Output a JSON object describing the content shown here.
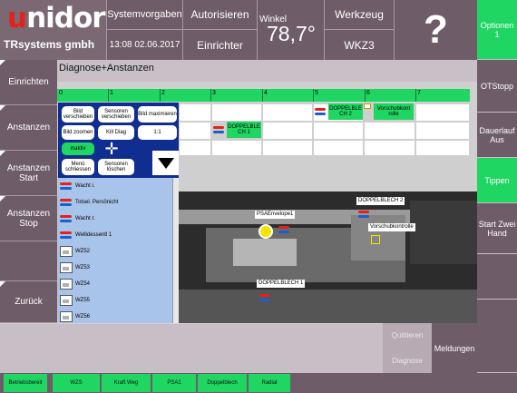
{
  "logo": {
    "brand": "unidor",
    "subtitle": "TRsystems gmbh"
  },
  "header": {
    "systemvorgaben": "Systemvorgaben",
    "datetime": "13:08 02.06.2017",
    "autorisieren": "Autorisieren",
    "einrichter": "Einrichter",
    "winkel_label": "Winkel",
    "winkel_value": "78,7°",
    "werkzeug_label": "Werkzeug",
    "werkzeug_value": "WKZ3",
    "help": "?"
  },
  "left_menu": [
    "Einrichten",
    "Anstanzen",
    "Anstanzen Start",
    "Anstanzen Stop",
    "Zurück"
  ],
  "right_menu": [
    "Optionen 1",
    "OTStopp",
    "Dauerlauf Aus",
    "Tippen",
    "Start Zwei Hand"
  ],
  "main": {
    "title": "Diagnose+Anstanzen",
    "ruler_marks": [
      "0",
      "1",
      "2",
      "3",
      "4",
      "5",
      "6",
      "7"
    ],
    "chips": {
      "doppelblech1": "DOPPELBLE CH 1",
      "doppelblech2": "DOPPELBLE CH 2",
      "vorschub": "Vorschubkont rolle"
    }
  },
  "panel": {
    "bild_verschieben": "Bild verschieben",
    "sensoren_verschieben": "Sensoren verschieben",
    "bild_maximieren": "Bild maximieren",
    "bild_zoomen": "Bild zoomen",
    "kill_diag": "Kill Diag",
    "ratio": "1:1",
    "inaktiv": "inaktiv",
    "menu_schliessen": "Menü schliessen",
    "sensoren_loeschen": "Sensoren löschen"
  },
  "sensor_list": [
    "Wacht i.",
    "Totsel. Persönicht",
    "Wacht r.",
    "Wellidessentl 1",
    "WZ52",
    "WZ53",
    "WZ54",
    "WZ55",
    "WZ56"
  ],
  "photo_labels": {
    "psa": "PSAEnvelope1",
    "db2": "DOPPELBLECH 2",
    "vorschub": "Vorschubkontrolle",
    "db1": "DOPPELBLECH 1"
  },
  "bottom": {
    "quittieren": "Quittieren",
    "diagnose": "Diagnose",
    "meldungen": "Meldungen"
  },
  "status_bar": [
    "Betriebsbereit",
    "WZS",
    "Kraft Weg",
    "PSA1",
    "Doppelblech",
    "Radial"
  ],
  "colors": {
    "accent_green": "#1fd662",
    "panel_blue": "#0f2e8f",
    "chrome": "#6e5d68",
    "logo_red": "#e2231a"
  }
}
